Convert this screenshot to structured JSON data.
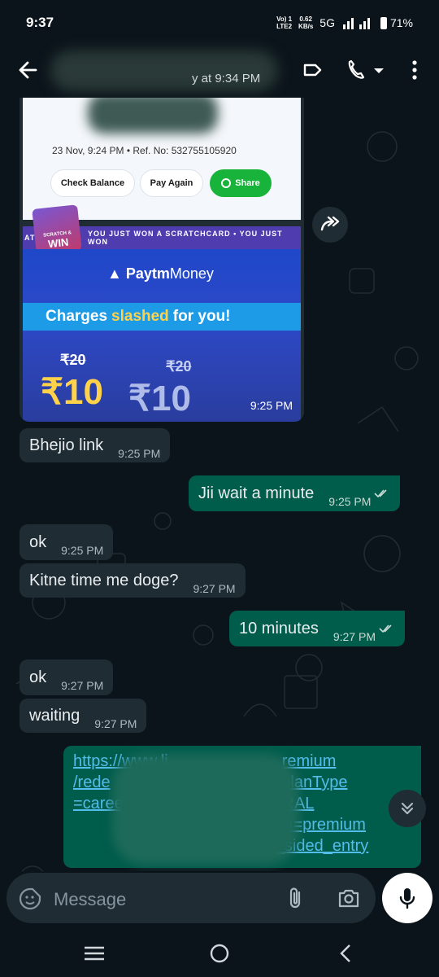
{
  "status": {
    "time": "9:37",
    "network_top": "Vo) 1",
    "network_bottom": "LTE2",
    "speed_top": "0.62",
    "speed_bottom": "KB/s",
    "signal": "5G",
    "battery": "71%"
  },
  "header": {
    "subtitle": "y at 9:34 PM"
  },
  "receipt": {
    "meta": "23 Nov, 9:24 PM  •  Ref. No: 532755105920",
    "check_balance": "Check Balance",
    "pay_again": "Pay Again",
    "share": "Share",
    "strip_text": "YOU JUST WON A SCRATCHCARD  •  YOU JUST WON",
    "strip_left": "ATC",
    "win_small": "SCRATCH &",
    "win": "WIN",
    "brand_bold": "Paytm",
    "brand_light": "Money",
    "charges_a": "Charges",
    "charges_b": "slashed",
    "charges_c": "for you!",
    "old_price_1": "₹20",
    "old_price_2": "₹20",
    "new_price_1": "₹10",
    "new_price_2": "₹10",
    "time": "9:25 PM"
  },
  "messages": [
    {
      "text": "Bhejio link",
      "time": "9:25 PM"
    },
    {
      "text": "Jii wait a minute",
      "time": "9:25 PM"
    },
    {
      "text": "ok",
      "time": "9:25 PM"
    },
    {
      "text": "Kitne time me doge?",
      "time": "9:27 PM"
    },
    {
      "text": "10 minutes",
      "time": "9:27 PM"
    },
    {
      "text": "ok",
      "time": "9:27 PM"
    },
    {
      "text": "waiting",
      "time": "9:27 PM"
    }
  ],
  "link": {
    "line1": "https://www.li",
    "line1b": "remium",
    "line2": "/rede",
    "line2b": "Fb&planType",
    "line3": "=caree",
    "line3b": "ERRAL",
    "line4": "",
    "line4b": "OrderOrigin=premium",
    "line5": "",
    "line5b": "omep_identity_2_sided_entry"
  },
  "input": {
    "placeholder": "Message"
  },
  "colors": {
    "background": "#0b141a",
    "incoming": "#1f2c33",
    "outgoing": "#005c4b",
    "link": "#53bdeb"
  }
}
